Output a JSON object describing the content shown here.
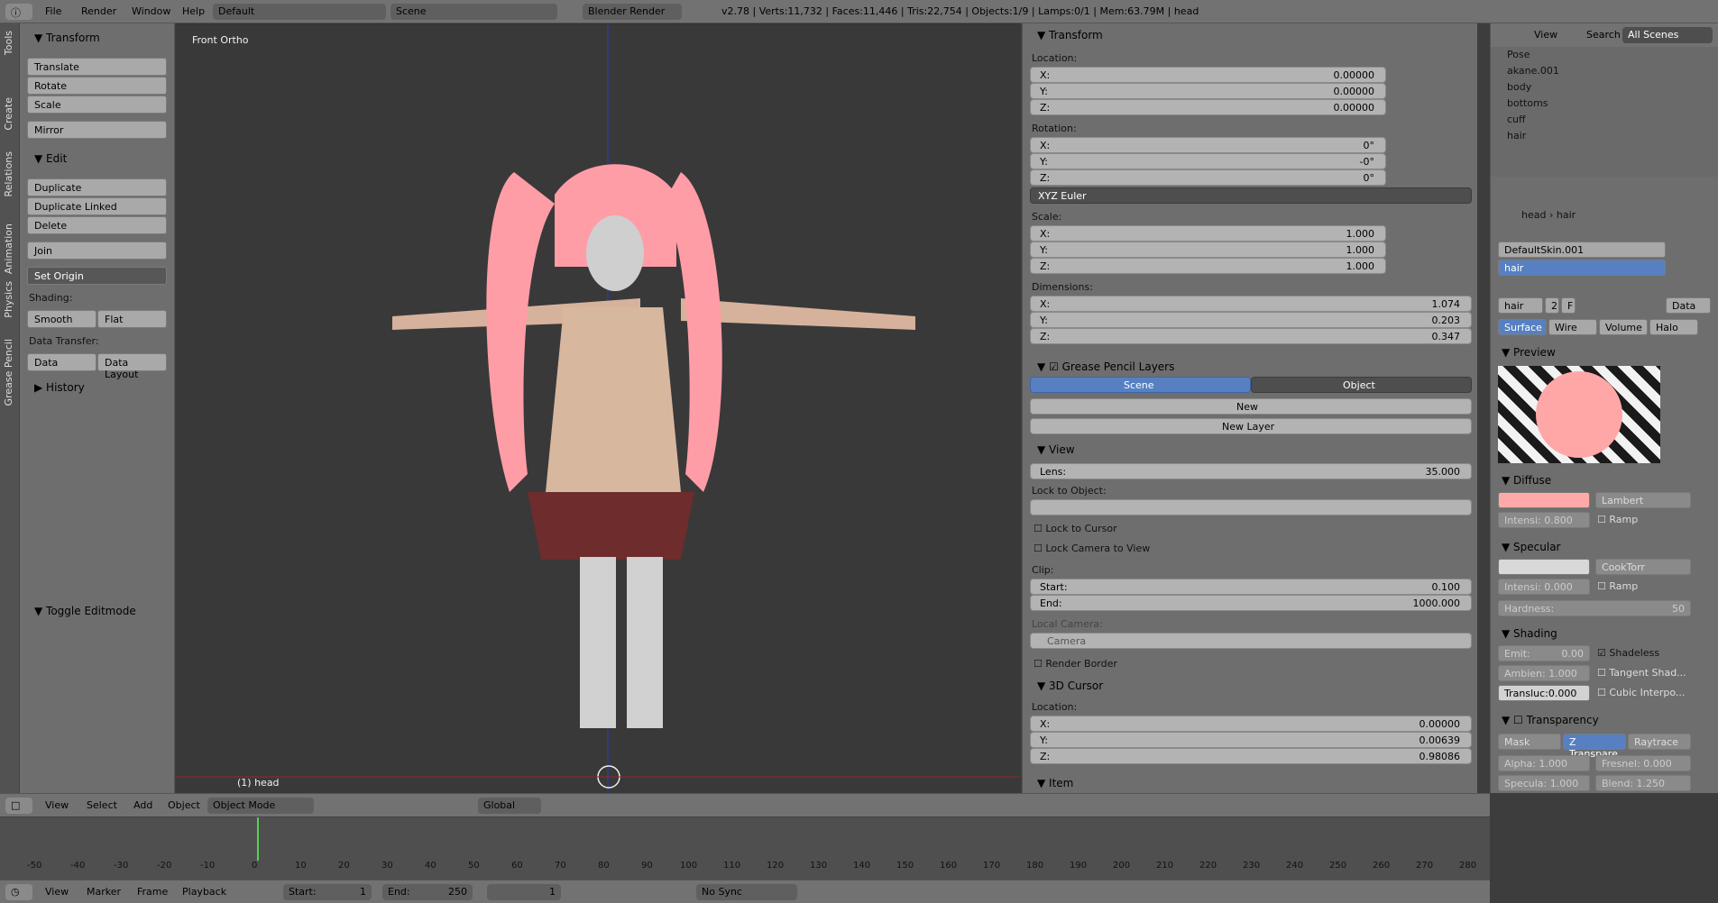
{
  "header": {
    "menu": [
      "File",
      "Render",
      "Window",
      "Help"
    ],
    "layout": "Default",
    "scene": "Scene",
    "engine": "Blender Render",
    "stats": "v2.78 | Verts:11,732 | Faces:11,446 | Tris:22,754 | Objects:1/9 | Lamps:0/1 | Mem:63.79M | head"
  },
  "tool_tabs": [
    "Tools",
    "Create",
    "Relations",
    "Animation",
    "Physics",
    "Grease Pencil"
  ],
  "tools": {
    "transform_header": "Transform",
    "translate": "Translate",
    "rotate": "Rotate",
    "scale": "Scale",
    "mirror": "Mirror",
    "edit_header": "Edit",
    "duplicate": "Duplicate",
    "duplicate_linked": "Duplicate Linked",
    "delete": "Delete",
    "join": "Join",
    "set_origin": "Set Origin",
    "shading": "Shading:",
    "smooth": "Smooth",
    "flat": "Flat",
    "data_transfer": "Data Transfer:",
    "data": "Data",
    "data_layout": "Data Layout",
    "history": "History",
    "toggle_editmode": "Toggle Editmode"
  },
  "viewport": {
    "title": "Front Ortho",
    "object_label": "(1) head",
    "mode": "Object Mode",
    "orientation": "Global"
  },
  "props": {
    "transform_header": "Transform",
    "location": "Location:",
    "loc": [
      "0.00000",
      "0.00000",
      "0.00000"
    ],
    "rotation": "Rotation:",
    "rot": [
      "0°",
      "-0°",
      "0°"
    ],
    "euler": "XYZ Euler",
    "scale": "Scale:",
    "scl": [
      "1.000",
      "1.000",
      "1.000"
    ],
    "dimensions": "Dimensions:",
    "dim": [
      "1.074",
      "0.203",
      "0.347"
    ],
    "gp_header": "Grease Pencil Layers",
    "scene_tab": "Scene",
    "object_tab": "Object",
    "new": "New",
    "new_layer": "New Layer",
    "view_header": "View",
    "lens_label": "Lens:",
    "lens": "35.000",
    "lock_obj": "Lock to Object:",
    "lock_cursor": "Lock to Cursor",
    "lock_camera": "Lock Camera to View",
    "clip": "Clip:",
    "start_label": "Start:",
    "start": "0.100",
    "end_label": "End:",
    "end": "1000.000",
    "local_camera": "Local Camera:",
    "camera": "Camera",
    "render_border": "Render Border",
    "cursor_header": "3D Cursor",
    "cursor_loc": "Location:",
    "cur": [
      "0.00000",
      "0.00639",
      "0.98086"
    ],
    "item_header": "Item"
  },
  "outliner": {
    "view": "View",
    "search": "Search",
    "scope": "All Scenes",
    "rows": [
      "Pose",
      "akane.001",
      "body",
      "bottoms",
      "cuff",
      "hair"
    ]
  },
  "material": {
    "path_obj": "head",
    "path_mat": "hair",
    "slots": [
      "DefaultSkin.001",
      "hair"
    ],
    "name": "hair",
    "users": "2",
    "f": "F",
    "data": "Data",
    "tabs": [
      "Surface",
      "Wire",
      "Volume",
      "Halo"
    ],
    "preview": "Preview",
    "diffuse": "Diffuse",
    "lambert": "Lambert",
    "intensity": "Intensi: 0.800",
    "ramp": "Ramp",
    "specular": "Specular",
    "cooktorr": "CookTorr",
    "spec_intensity": "Intensi: 0.000",
    "hardness": "Hardness:",
    "hardness_value": "50",
    "shading": "Shading",
    "emit": "Emit:",
    "emit_value": "0.00",
    "shadeless": "Shadeless",
    "ambient": "Ambien: 1.000",
    "tangent": "Tangent Shad...",
    "transluc": "Transluc:0.000",
    "cubic": "Cubic Interpo...",
    "transparency": "Transparency",
    "mask": "Mask",
    "ztransp": "Z Transpare...",
    "raytrace": "Raytrace",
    "alpha": "Alpha: 1.000",
    "fresnel": "Fresnel: 0.000",
    "specula": "Specula: 1.000",
    "blend": "Blend: 1.250",
    "diffuse_color": "#ffaaa8"
  },
  "timeline": {
    "ticks": [
      "-50",
      "-40",
      "-30",
      "-20",
      "-10",
      "0",
      "10",
      "20",
      "30",
      "40",
      "50",
      "60",
      "70",
      "80",
      "90",
      "100",
      "110",
      "120",
      "130",
      "140",
      "150",
      "160",
      "170",
      "180",
      "190",
      "200",
      "210",
      "220",
      "230",
      "240",
      "250",
      "260",
      "270",
      "280"
    ],
    "menus": [
      "View",
      "Marker",
      "Frame",
      "Playback"
    ],
    "start_label": "Start:",
    "start": "1",
    "end_label": "End:",
    "end": "250",
    "current": "1",
    "sync": "No Sync"
  },
  "bottom_menus": [
    "View",
    "Select",
    "Add",
    "Object"
  ]
}
